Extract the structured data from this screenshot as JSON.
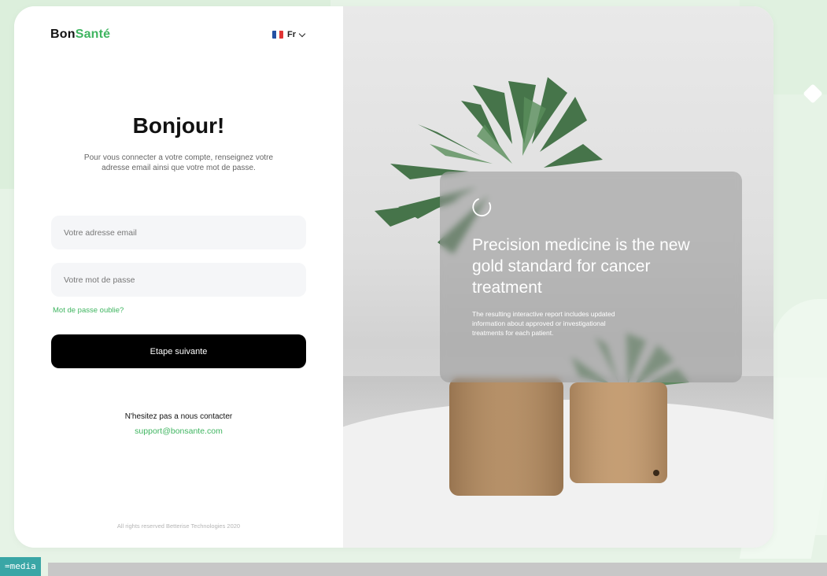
{
  "brand": {
    "part1": "Bon",
    "part2": "Santé"
  },
  "language": {
    "label": "Fr"
  },
  "login": {
    "title": "Bonjour!",
    "subtitle": "Pour vous connecter a votre compte, renseignez votre adresse email ainsi que votre mot de passe.",
    "email_placeholder": "Votre adresse email",
    "password_placeholder": "Votre mot de passe",
    "forgot_label": "Mot de passe oublie?",
    "submit_label": "Etape suivante",
    "contact_text": "N'hesitez pas a nous contacter",
    "support_email": "support@bonsante.com",
    "copyright": "All rights reserved Betterise Technologies 2020"
  },
  "promo": {
    "headline": "Precision medicine is the new gold standard for cancer treatment",
    "description": "The resulting interactive report includes updated information about approved or investigational treatments for each patient."
  },
  "overlay": {
    "media_tag": "=media"
  },
  "colors": {
    "accent": "#3fb560",
    "button": "#000000"
  },
  "icons": [
    "france-flag-icon",
    "chevron-down-icon",
    "loading-spinner-icon"
  ]
}
